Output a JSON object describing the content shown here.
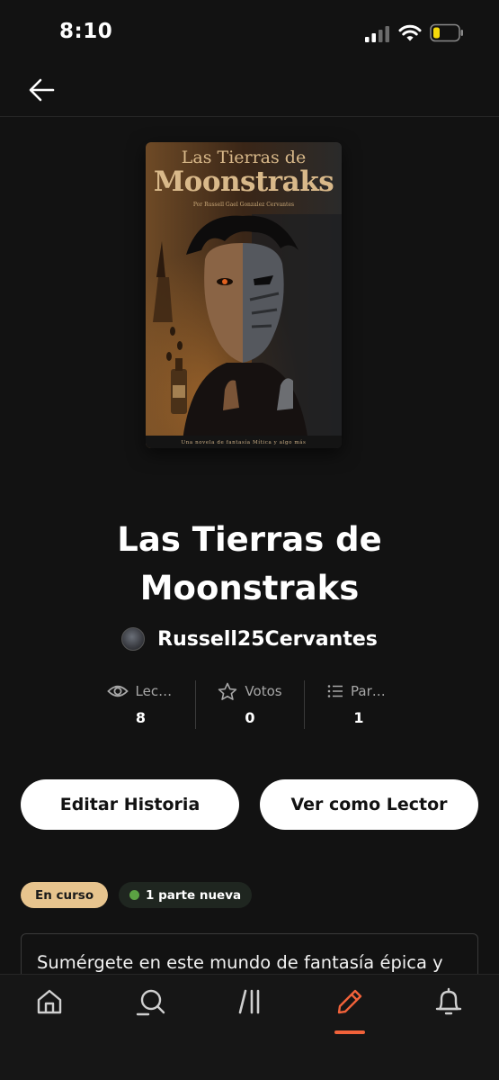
{
  "status_bar": {
    "time": "8:10"
  },
  "cover": {
    "title_line1": "Las Tierras de",
    "title_line2": "Moonstraks",
    "author_line": "Por Russell Gael Gonzalez Cervantes",
    "tagline": "Una novela de fantasía Mítica y algo más"
  },
  "story": {
    "title": "Las Tierras de Moonstraks",
    "author": "Russell25Cervantes"
  },
  "stats": [
    {
      "icon": "eye-icon",
      "label": "Lecturas",
      "value": "8"
    },
    {
      "icon": "star-icon",
      "label": "Votos",
      "value": "0"
    },
    {
      "icon": "list-icon",
      "label": "Partes",
      "value": "1"
    }
  ],
  "actions": {
    "edit_label": "Editar Historia",
    "read_label": "Ver como Lector"
  },
  "badges": {
    "status": "En curso",
    "new_parts": "1 parte nueva"
  },
  "description": "Sumérgete en este mundo de fantasía épica y",
  "tabbar": {
    "items": [
      "home-icon",
      "search-icon",
      "library-icon",
      "write-icon",
      "notifications-icon"
    ],
    "active": "write-icon",
    "accent": "#f1623a"
  },
  "colors": {
    "background": "#121212",
    "status_badge": "#e7c48e",
    "new_dot": "#5ba243"
  }
}
